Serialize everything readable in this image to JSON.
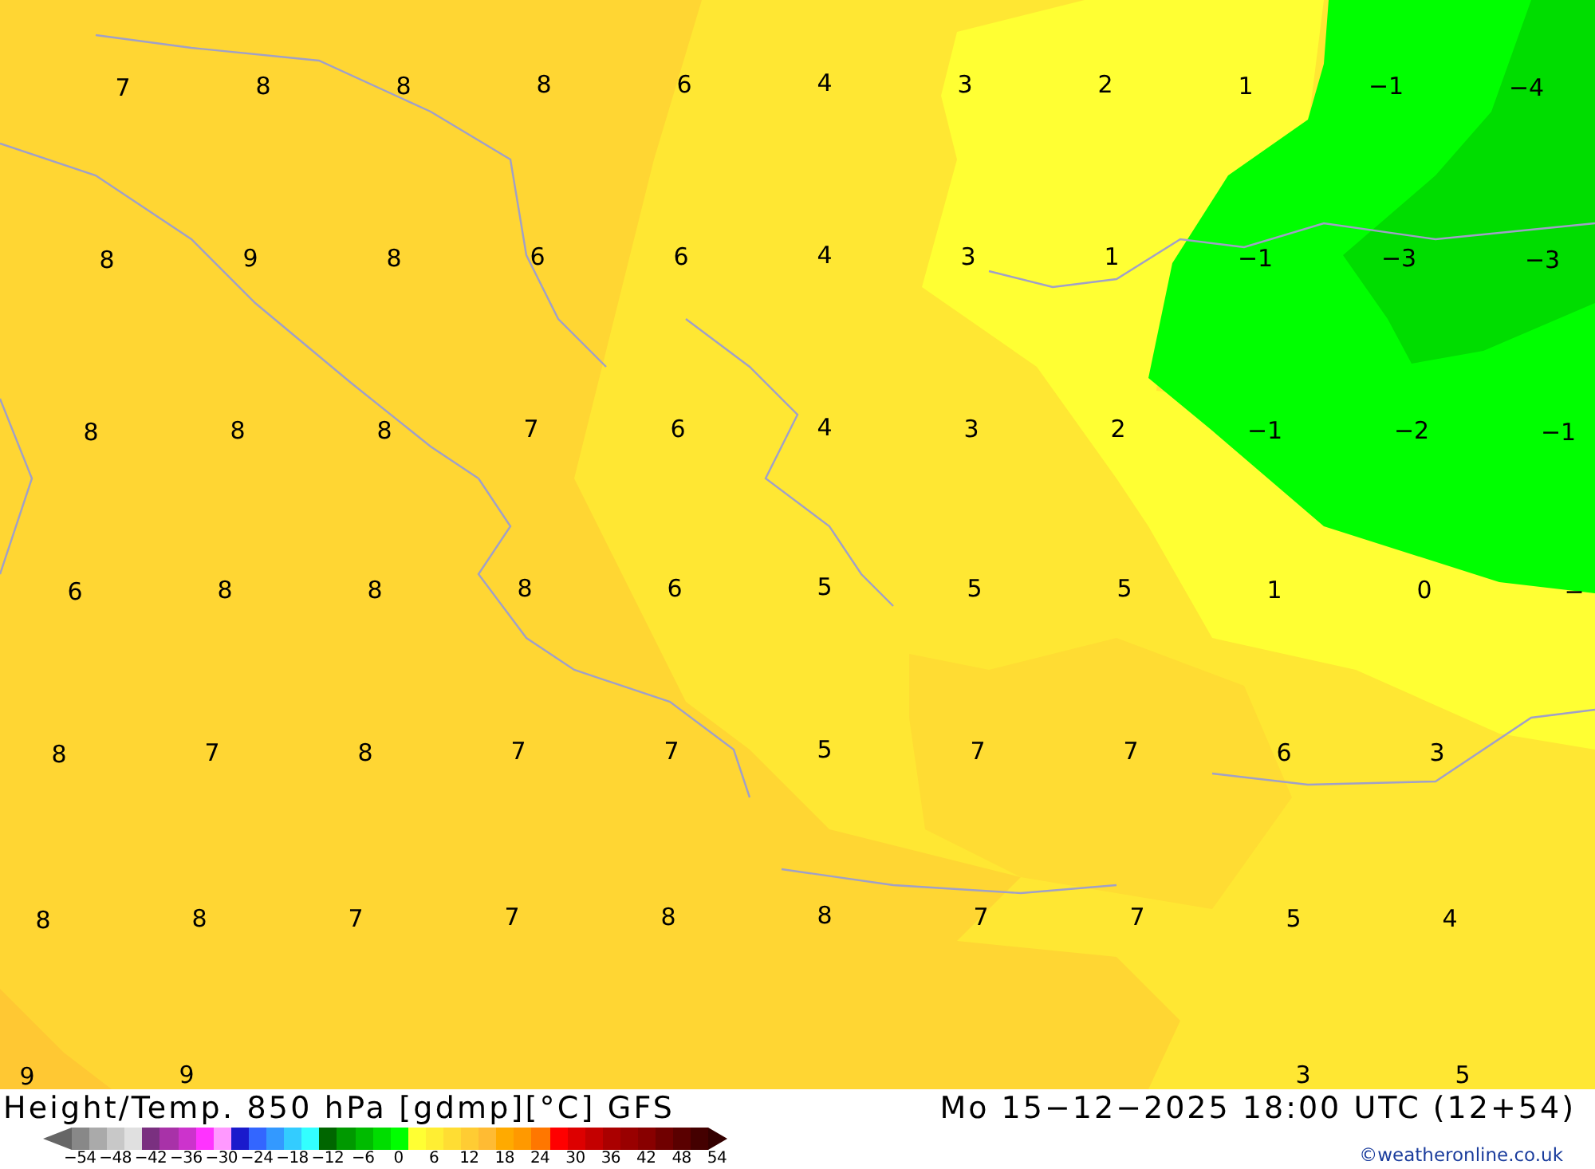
{
  "map": {
    "label_rows": [
      [
        "7",
        "8",
        "8",
        "8",
        "6",
        "4",
        "3",
        "2",
        "1",
        "−1",
        "−4"
      ],
      [
        "8",
        "9",
        "8",
        "6",
        "6",
        "4",
        "3",
        "1",
        "−1",
        "−3",
        "−3"
      ],
      [
        "8",
        "8",
        "8",
        "7",
        "6",
        "4",
        "3",
        "2",
        "−1",
        "−2",
        "−1"
      ],
      [
        "6",
        "8",
        "8",
        "8",
        "6",
        "5",
        "5",
        "5",
        "1",
        "0",
        "−"
      ],
      [
        "8",
        "7",
        "8",
        "7",
        "7",
        "5",
        "7",
        "7",
        "6",
        "3",
        null
      ],
      [
        "8",
        "8",
        "7",
        "7",
        "8",
        "8",
        "7",
        "7",
        "5",
        "4"
      ],
      [
        "9",
        "9",
        null,
        null,
        null,
        null,
        null,
        null,
        "3",
        "5"
      ]
    ]
  },
  "title": "Height/Temp. 850 hPa [gdmp][°C] GFS",
  "valid_time": "Mo 15−12−2025 18:00 UTC (12+54)",
  "colorbar": {
    "swatches": [
      {
        "color": "#888888"
      },
      {
        "color": "#aaaaaa"
      },
      {
        "color": "#c8c8c8"
      },
      {
        "color": "#e0e0e0"
      },
      {
        "color": "#7a3080"
      },
      {
        "color": "#a832a8"
      },
      {
        "color": "#cc33cc"
      },
      {
        "color": "#ff33ff"
      },
      {
        "color": "#ff99ff"
      },
      {
        "color": "#1a1acc"
      },
      {
        "color": "#3366ff"
      },
      {
        "color": "#3399ff"
      },
      {
        "color": "#33ccff"
      },
      {
        "color": "#33ffff"
      },
      {
        "color": "#006600"
      },
      {
        "color": "#009900"
      },
      {
        "color": "#00bb00"
      },
      {
        "color": "#00dd00"
      },
      {
        "color": "#00ff00"
      },
      {
        "color": "#ffff33"
      },
      {
        "color": "#ffee33"
      },
      {
        "color": "#ffdd33"
      },
      {
        "color": "#ffcc33"
      },
      {
        "color": "#ffbb33"
      },
      {
        "color": "#ffaa00"
      },
      {
        "color": "#ff9900"
      },
      {
        "color": "#ff7700"
      },
      {
        "color": "#ff0000"
      },
      {
        "color": "#dd0000"
      },
      {
        "color": "#c40000"
      },
      {
        "color": "#aa0000"
      },
      {
        "color": "#990000"
      },
      {
        "color": "#880000"
      },
      {
        "color": "#700000"
      },
      {
        "color": "#5a0000"
      },
      {
        "color": "#440000"
      }
    ],
    "ticks": [
      "−54",
      "−48",
      "−42",
      "−36",
      "−30",
      "−24",
      "−18",
      "−12",
      "−6",
      "0",
      "6",
      "12",
      "18",
      "24",
      "30",
      "36",
      "42",
      "48",
      "54"
    ]
  },
  "credit": "©weatheronline.co.uk"
}
